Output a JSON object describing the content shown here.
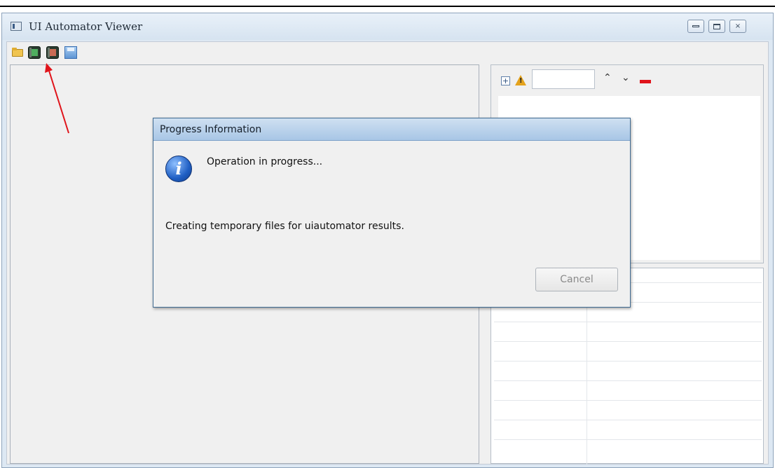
{
  "window": {
    "title": "UI Automator Viewer"
  },
  "window_buttons": {
    "minimize": "minimize-icon",
    "maximize": "maximize-icon",
    "close": "×"
  },
  "toolbar": {
    "items": [
      "open-folder-icon",
      "device-screenshot-icon",
      "device-screenshot-compressed-icon",
      "save-icon"
    ]
  },
  "hierarchy_toolbar": {
    "icons": [
      "expand-all-icon",
      "warning-icon",
      "arrow-up-icon",
      "arrow-down-icon",
      "clear-icon"
    ],
    "search_value": "",
    "up_glyph": "⌃",
    "down_glyph": "⌄"
  },
  "dialog": {
    "title": "Progress Information",
    "message": "Operation in progress...",
    "detail": "Creating temporary files for uiautomator results.",
    "cancel_label": "Cancel"
  },
  "colors": {
    "accent_arrow": "#e0141b",
    "dialog_title": "#a8c6e6"
  }
}
